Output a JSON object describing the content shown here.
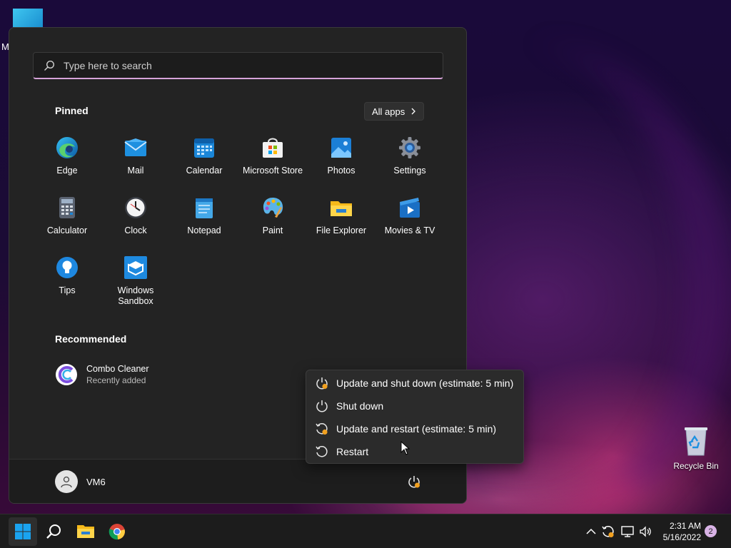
{
  "desktop": {
    "partial_label": "M",
    "recycle_bin_label": "Recycle Bin"
  },
  "start_menu": {
    "search_placeholder": "Type here to search",
    "pinned_title": "Pinned",
    "all_apps_label": "All apps",
    "pinned_apps": [
      {
        "label": "Edge",
        "icon": "edge-icon"
      },
      {
        "label": "Mail",
        "icon": "mail-icon"
      },
      {
        "label": "Calendar",
        "icon": "calendar-icon"
      },
      {
        "label": "Microsoft Store",
        "icon": "store-icon"
      },
      {
        "label": "Photos",
        "icon": "photos-icon"
      },
      {
        "label": "Settings",
        "icon": "gear-icon"
      },
      {
        "label": "Calculator",
        "icon": "calculator-icon"
      },
      {
        "label": "Clock",
        "icon": "clock-icon"
      },
      {
        "label": "Notepad",
        "icon": "notepad-icon"
      },
      {
        "label": "Paint",
        "icon": "paint-icon"
      },
      {
        "label": "File Explorer",
        "icon": "folder-icon"
      },
      {
        "label": "Movies & TV",
        "icon": "movies-icon"
      },
      {
        "label": "Tips",
        "icon": "lightbulb-icon"
      },
      {
        "label": "Windows Sandbox",
        "icon": "sandbox-icon"
      }
    ],
    "recommended_title": "Recommended",
    "recommended": [
      {
        "title": "Combo Cleaner",
        "subtitle": "Recently added",
        "icon": "combo-cleaner-icon"
      }
    ],
    "user_name": "VM6"
  },
  "power_menu": {
    "items": [
      {
        "label": "Update and shut down (estimate: 5 min)",
        "icon": "update-power-icon"
      },
      {
        "label": "Shut down",
        "icon": "power-icon"
      },
      {
        "label": "Update and restart (estimate: 5 min)",
        "icon": "update-restart-icon"
      },
      {
        "label": "Restart",
        "icon": "restart-icon"
      }
    ]
  },
  "taskbar": {
    "time": "2:31 AM",
    "date": "5/16/2022",
    "notification_count": "2"
  },
  "colors": {
    "accent_orange": "#f0a020",
    "windows_blue": "#1aa3f0",
    "search_underline": "#d6a3d8"
  }
}
